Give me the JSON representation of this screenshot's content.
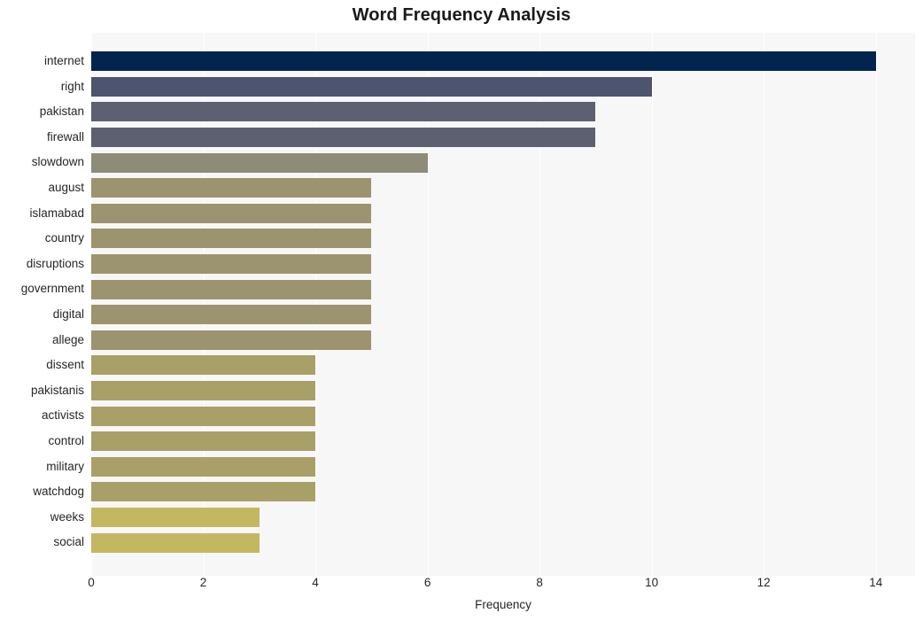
{
  "chart_data": {
    "type": "bar",
    "orientation": "horizontal",
    "title": "Word Frequency Analysis",
    "xlabel": "Frequency",
    "ylabel": "",
    "categories": [
      "internet",
      "right",
      "pakistan",
      "firewall",
      "slowdown",
      "august",
      "islamabad",
      "country",
      "disruptions",
      "government",
      "digital",
      "allege",
      "dissent",
      "pakistanis",
      "activists",
      "control",
      "military",
      "watchdog",
      "weeks",
      "social"
    ],
    "values": [
      14,
      10,
      9,
      9,
      6,
      5,
      5,
      5,
      5,
      5,
      5,
      5,
      4,
      4,
      4,
      4,
      4,
      4,
      3,
      3
    ],
    "bar_colors": [
      "#042450",
      "#4c5470",
      "#5c6070",
      "#5c6070",
      "#8e8b78",
      "#9c9470",
      "#9c9470",
      "#9c9470",
      "#9c9470",
      "#9c9470",
      "#9c9470",
      "#9c9470",
      "#a9a068",
      "#a9a068",
      "#a9a068",
      "#a9a068",
      "#a9a068",
      "#a9a068",
      "#c4b762",
      "#c4b762"
    ],
    "xticks": [
      0,
      2,
      4,
      6,
      8,
      10,
      12,
      14
    ],
    "xtick_labels": [
      "0",
      "2",
      "4",
      "6",
      "8",
      "10",
      "12",
      "14"
    ],
    "xlim": [
      0,
      14.7
    ],
    "grid": "vertical-white",
    "plot_background": "#f7f7f7",
    "figure_background": "#ffffff",
    "legend": null
  }
}
